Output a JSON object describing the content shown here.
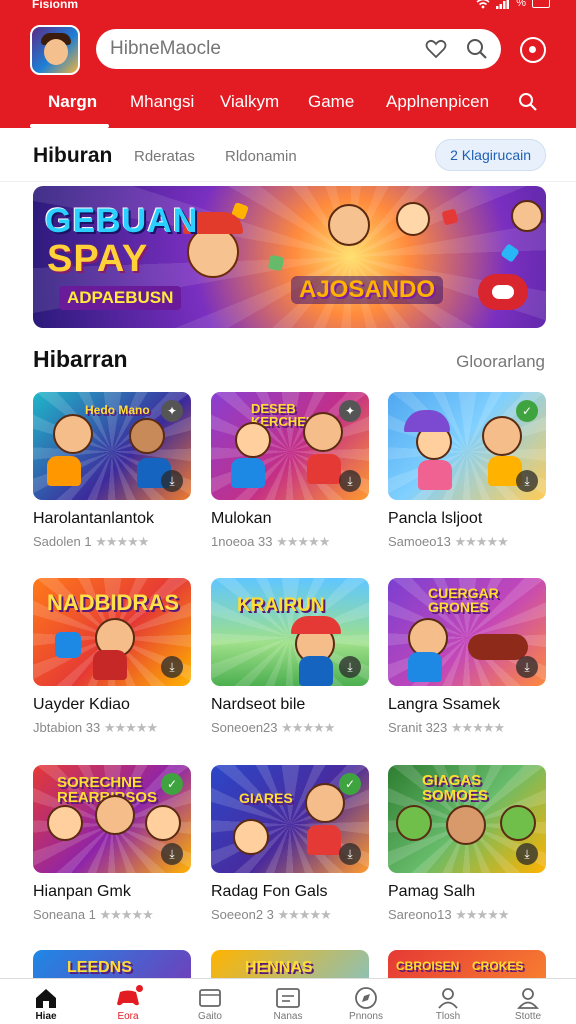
{
  "status": {
    "time": "Fisionm",
    "battery": "%"
  },
  "search": {
    "placeholder": "HibneMaocle"
  },
  "tabs": [
    "Nargn",
    "Mhangsi",
    "Vialkym",
    "Game",
    "Applnenpicen"
  ],
  "section1": {
    "title": "Hiburan",
    "sub1": "Rderatas",
    "sub2": "Rldonamin",
    "chip": "2 Klagirucain"
  },
  "banner": {
    "line1": "GEBUAN",
    "line2": "SPAY",
    "line3": "ADPAEBUSN",
    "line4": "AJOSANDO"
  },
  "section2": {
    "title": "Hibarran",
    "more": "Gloorarlang"
  },
  "cards": [
    {
      "name": "Harolantanlantok",
      "meta": "Sadolen 1",
      "stars": "★★★★★",
      "label": "Hedo Mano"
    },
    {
      "name": "Mulokan",
      "meta": "1noeoa 33",
      "stars": "★★★★★",
      "label": "DESEB KERCHELER"
    },
    {
      "name": "Pancla lsljoot",
      "meta": "Samoeo13",
      "stars": "★★★★★",
      "label": ""
    },
    {
      "name": "Uayder Kdiao",
      "meta": "Jbtabion 33",
      "stars": "★★★★★",
      "label": "NADBIDRAS"
    },
    {
      "name": "Nardseot bile",
      "meta": "Soneoen23",
      "stars": "★★★★★",
      "label": "KRAIRUN"
    },
    {
      "name": "Langra Ssamek",
      "meta": "Sranit 323",
      "stars": "★★★★★",
      "label": "CUERGAR GRONES"
    },
    {
      "name": "Hianpan Gmk",
      "meta": "Soneana 1",
      "stars": "★★★★★",
      "label": "SORECHNE REARBIRSOS"
    },
    {
      "name": "Radag Fon Gals",
      "meta": "Soeeon2 3",
      "stars": "★★★★★",
      "label": "GIARES"
    },
    {
      "name": "Pamag Salh",
      "meta": "Sareono13",
      "stars": "★★★★★",
      "label": "GIAGAS SOMOES"
    }
  ],
  "peek": [
    "LEEDNS",
    "HENNAS",
    "CBROISEN",
    "CROKES"
  ],
  "bottom_nav": [
    "Hiae",
    "Eora",
    "Gaito",
    "Nanas",
    "Pnnons",
    "Tlosh",
    "Stotte"
  ],
  "colors": {
    "brand": "#e31b23",
    "chip_text": "#1f5fb5"
  }
}
